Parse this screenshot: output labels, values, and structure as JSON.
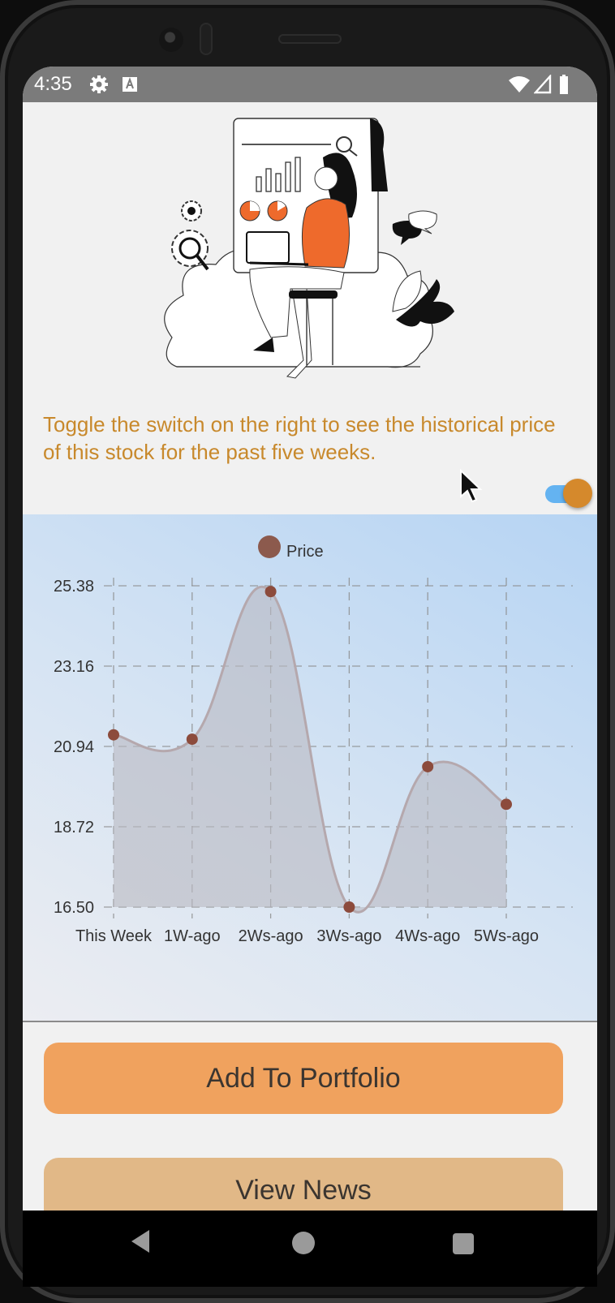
{
  "status_bar": {
    "time": "4:35",
    "icons": [
      "settings-icon",
      "accessibility-text-icon",
      "wifi-icon",
      "signal-icon",
      "battery-icon"
    ]
  },
  "intro": {
    "text": "Toggle the switch on the right to see the historical price of this stock for the past five weeks."
  },
  "history_toggle": {
    "on": true
  },
  "chart_data": {
    "type": "area",
    "legend": [
      "Price"
    ],
    "categories": [
      "This Week",
      "1W-ago",
      "2Ws-ago",
      "3Ws-ago",
      "4Ws-ago",
      "5Ws-ago"
    ],
    "series": [
      {
        "name": "Price",
        "values": [
          21.26,
          21.14,
          25.22,
          16.5,
          20.38,
          19.34
        ]
      }
    ],
    "yticks": [
      "16.50",
      "18.72",
      "20.94",
      "23.16",
      "25.38"
    ],
    "ylim": [
      16.5,
      25.38
    ],
    "grid": true,
    "smooth": true,
    "colors": {
      "point": "#8c4b3c",
      "line": "#b5a8ad",
      "fill": "#b9b9c1",
      "legend": "#8c5a4d"
    }
  },
  "buttons": {
    "add_to_portfolio": "Add To Portfolio",
    "view_news": "View News"
  },
  "colors": {
    "accent_text": "#c8892c",
    "toggle_thumb": "#d5892c",
    "toggle_track": "#64b3f1",
    "primary_button": "#f0a25e",
    "secondary_button": "#e1b887"
  },
  "nav_bar": {
    "icons": [
      "back-icon",
      "home-icon",
      "recents-icon"
    ]
  }
}
